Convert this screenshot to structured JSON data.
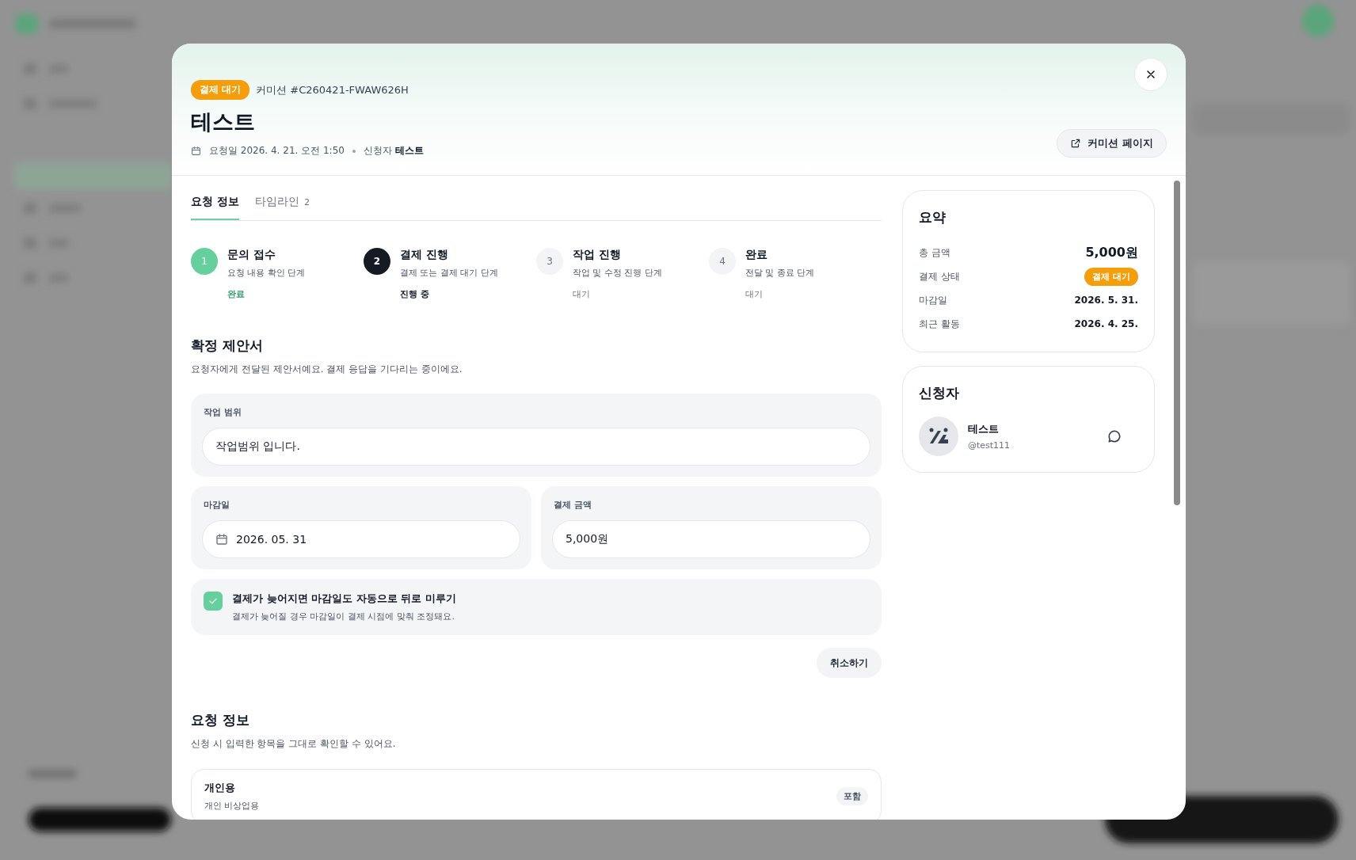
{
  "header": {
    "status_badge": "결제 대기",
    "commission_id": "커미션 #C260421-FWAW626H",
    "title": "테스트",
    "requested": "요청일 2026. 4. 21. 오전 1:50",
    "applicant_line": "신청자 **테스트**",
    "page_button": "커미션 페이지"
  },
  "tabs": [
    {
      "label": "요청 정보",
      "selected": true
    },
    {
      "label": "타임라인",
      "count": "2",
      "selected": false
    }
  ],
  "steps": [
    {
      "number": "1",
      "title": "문의 접수",
      "description": "요청 내용 확인 단계",
      "status": "완료",
      "kind": "done"
    },
    {
      "number": "2",
      "title": "결제 진행",
      "description": "결제 또는 결제 대기 단계",
      "status": "진행 중",
      "kind": "current"
    },
    {
      "number": "3",
      "title": "작업 진행",
      "description": "작업 및 수정 진행 단계",
      "status": "대기",
      "kind": "pending"
    },
    {
      "number": "4",
      "title": "완료",
      "description": "전달 및 종료 단계",
      "status": "대기",
      "kind": "pending"
    }
  ],
  "proposal": {
    "title": "확정 제안서",
    "description": "요청자에게 전달된 제안서예요. 결제 응답을 기다리는 중이에요.",
    "scope": {
      "label": "작업 범위",
      "value": "작업범위 입니다."
    },
    "deadline": {
      "label": "마감일",
      "value": "2026. 05. 31"
    },
    "amount": {
      "label": "결제 금액",
      "value": "5,000원"
    },
    "auto_postpone": {
      "label": "결제가 늦어지면 마감일도 자동으로 뒤로 미루기",
      "hint": "결제가 늦어질 경우 마감일이 결제 시점에 맞춰 조정돼요.",
      "checked": true
    },
    "cancel_button": "취소하기"
  },
  "request_info": {
    "title": "요청 정보",
    "description": "신청 시 입력한 항목을 그대로 확인할 수 있어요.",
    "items": [
      {
        "title": "개인용",
        "description": "개인 비상업용",
        "tag": "포함"
      }
    ]
  },
  "summary": {
    "title": "요약",
    "rows": [
      {
        "label": "총 금액",
        "value": "5,000원",
        "kind": "amount"
      },
      {
        "label": "결제 상태",
        "value": "결제 대기",
        "kind": "badge"
      },
      {
        "label": "마감일",
        "value": "2026. 5. 31.",
        "kind": "text"
      },
      {
        "label": "최근 활동",
        "value": "2026. 4. 25.",
        "kind": "text"
      }
    ]
  },
  "applicant": {
    "title": "신청자",
    "name": "테스트",
    "handle": "@test111"
  }
}
